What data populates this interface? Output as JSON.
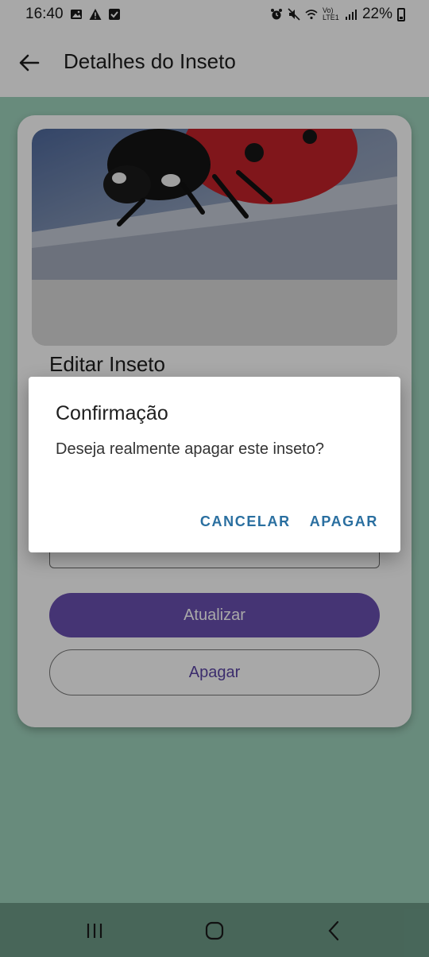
{
  "status_bar": {
    "time": "16:40",
    "battery": "22%",
    "network_label": "Vo) LTE1"
  },
  "app_bar": {
    "title": "Detalhes do Inseto",
    "back_icon": "arrow-left-icon"
  },
  "card": {
    "photo_subject": "ladybug",
    "heading": "Editar Inseto",
    "update_button": "Atualizar",
    "delete_button": "Apagar"
  },
  "dialog": {
    "title": "Confirmação",
    "message": "Deseja realmente apagar este inseto?",
    "cancel_button": "CANCELAR",
    "confirm_button": "APAGAR"
  },
  "nav_bar": {
    "recents_icon": "recents-icon",
    "home_icon": "home-icon",
    "back_icon": "nav-back-icon"
  },
  "colors": {
    "background": "#9fd3bd",
    "primary": "#6a4fb0",
    "dialog_action": "#2a6fa0"
  }
}
